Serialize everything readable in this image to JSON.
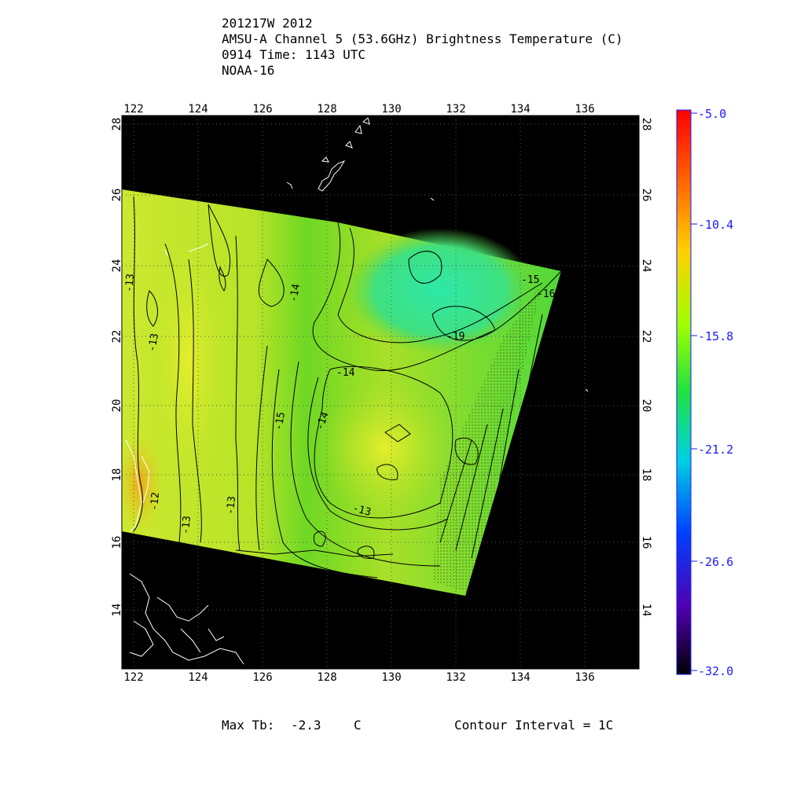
{
  "title": {
    "line1": "201217W 2012",
    "line2": "AMSU-A Channel 5 (53.6GHz) Brightness Temperature (C)",
    "line3": "0914 Time: 1143 UTC",
    "line4": "NOAA-16"
  },
  "axes": {
    "lon_ticks": [
      "122",
      "124",
      "126",
      "128",
      "130",
      "132",
      "134",
      "136"
    ],
    "lat_ticks": [
      "28",
      "26",
      "24",
      "22",
      "20",
      "18",
      "16",
      "14"
    ]
  },
  "colorbar": {
    "labels": [
      "-5.0",
      "-10.4",
      "-15.8",
      "-21.2",
      "-26.6",
      "-32.0"
    ],
    "min": -32.0,
    "max": -5.0
  },
  "contour_labels": [
    "-13",
    "-13",
    "-14",
    "-14",
    "-15",
    "-14",
    "-19",
    "-13",
    "-12",
    "-13",
    "-13",
    "-15",
    "-16"
  ],
  "footer": {
    "max_tb_label": "Max Tb:",
    "max_tb_value": "-2.3",
    "max_tb_unit": "C",
    "contour_interval": "Contour Interval = 1C"
  },
  "colors": {
    "swath_main": "#9fe020",
    "swath_yellow": "#d6ec28",
    "swath_cyan": "#2fe8a0",
    "background": "#000000",
    "tick_blue": "#1a1aff"
  }
}
